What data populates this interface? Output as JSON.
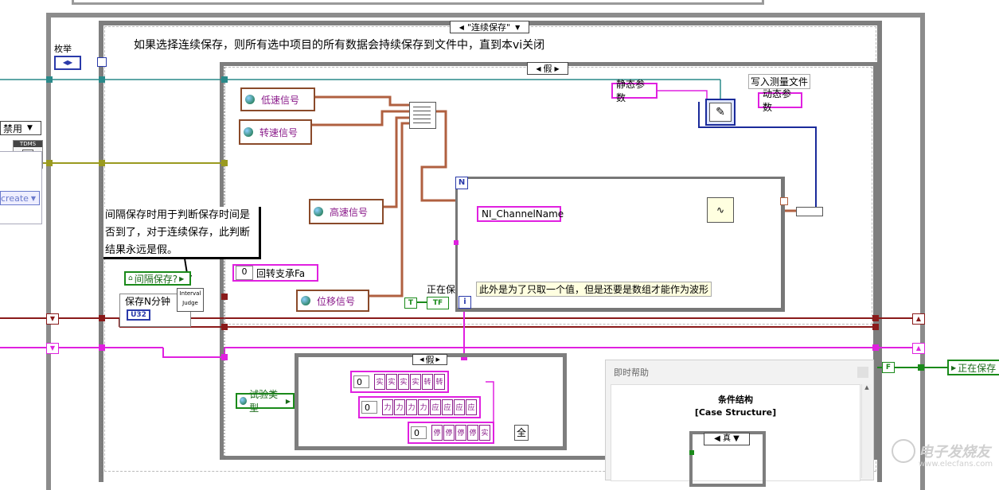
{
  "outer_case": {
    "selector_label": "\"连续保存\""
  },
  "comment": {
    "text": "如果选择连续保存，则所有选中项目的所有数据会持续保存到文件中，直到本vi关闭"
  },
  "inner_case": {
    "selector_label": "假"
  },
  "bottom_case": {
    "selector_label": "假"
  },
  "left_controls": {
    "enum_label": "枚举",
    "disable_label": "禁用",
    "tdms_label": "TDMS",
    "create_label": "create",
    "note_text": "间隔保存时用于判断保存时间是否到了，对于连续保存，此判断结果永远是假。",
    "interval_save": "间隔保存?",
    "save_n_min": "保存N分钟",
    "u32_tag": "U32",
    "interval_judge": "Interval Judge"
  },
  "signals": {
    "low_speed": "低速信号",
    "rotate_speed": "转速信号",
    "high_speed": "高速信号",
    "displacement": "位移信号",
    "test_type": "试验类型"
  },
  "constants": {
    "rotor_bearing": "回转支承Fa",
    "rotor_value": "0",
    "true_const": "T",
    "tf_tag": "TF",
    "saving_label": "正在保",
    "saving_right": "正在保存",
    "false_const": "F",
    "static_params": "静态参数",
    "dynamic_params": "动态参数",
    "write_file": "写入测量文件",
    "channel_name": "NI_ChannelName",
    "for_loop_n": "N",
    "for_loop_i": "i",
    "loop_comment": "此外是为了只取一个值，但是还要是数组才能作为波形",
    "all_label": "全",
    "array_index": "0"
  },
  "arrays": {
    "row1": [
      "实",
      "实",
      "实",
      "实",
      "转",
      "转"
    ],
    "row2": [
      "力",
      "力",
      "力",
      "力",
      "应",
      "应",
      "应",
      "应"
    ],
    "row3": [
      "停",
      "停",
      "停",
      "停",
      "实"
    ]
  },
  "help_window": {
    "title": "即时帮助",
    "heading": "条件结构",
    "subheading": "[Case Structure]",
    "preview_label": "真"
  },
  "watermark": {
    "text": "电子发烧友",
    "url_text": "www.elecfans.com"
  }
}
